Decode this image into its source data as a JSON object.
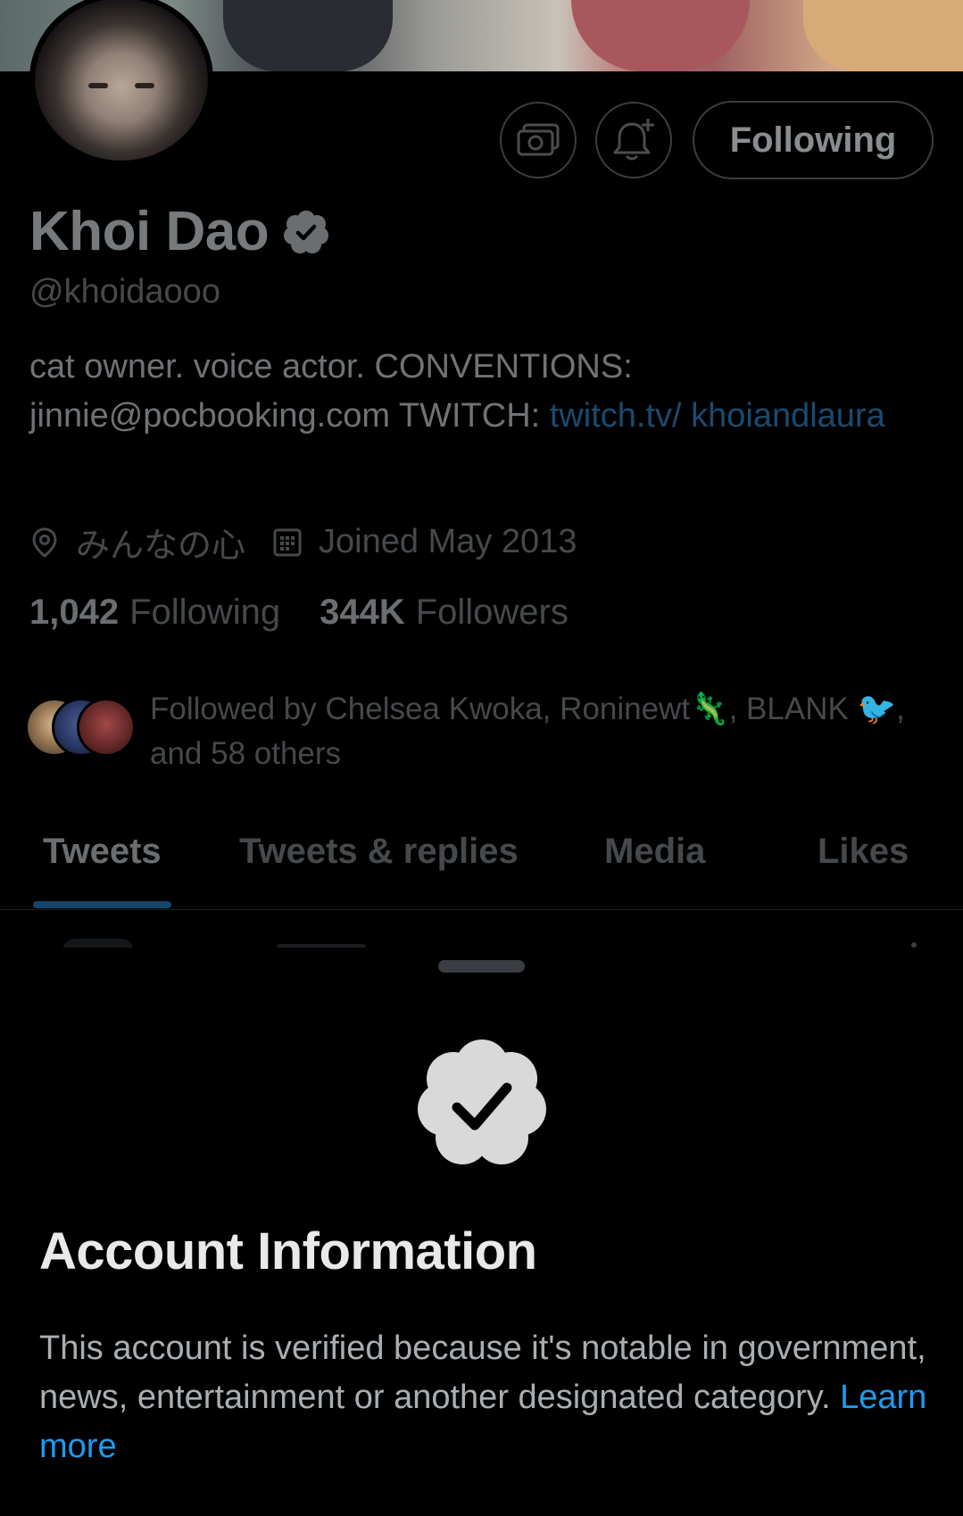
{
  "profile": {
    "display_name": "Khoi Dao",
    "handle": "@khoidaooo",
    "bio_text": "cat owner. voice actor. CONVENTIONS: jinnie@pocbooking.com TWITCH: ",
    "bio_link": "twitch.tv/ khoiandlaura",
    "location": "みんなの心",
    "joined": "Joined May 2013",
    "following_count": "1,042",
    "following_label": "Following",
    "followers_count": "344K",
    "followers_label": "Followers",
    "followed_by_text": "Followed by Chelsea Kwoka, Roninewt🦎, BLANK 🐦, and 58 others"
  },
  "actions": {
    "following_button": "Following",
    "icons": [
      "money-icon",
      "bell-plus-icon"
    ]
  },
  "tabs": [
    {
      "label": "Tweets",
      "active": true
    },
    {
      "label": "Tweets & replies",
      "active": false
    },
    {
      "label": "Media",
      "active": false
    },
    {
      "label": "Likes",
      "active": false
    }
  ],
  "sheet": {
    "title": "Account Information",
    "body": "This account is verified because it's notable in government, news, entertainment or another designated category. ",
    "learn_more": "Learn more"
  },
  "colors": {
    "accent": "#1d9bf0",
    "background": "#000000",
    "badge": "#d9d9d9"
  }
}
